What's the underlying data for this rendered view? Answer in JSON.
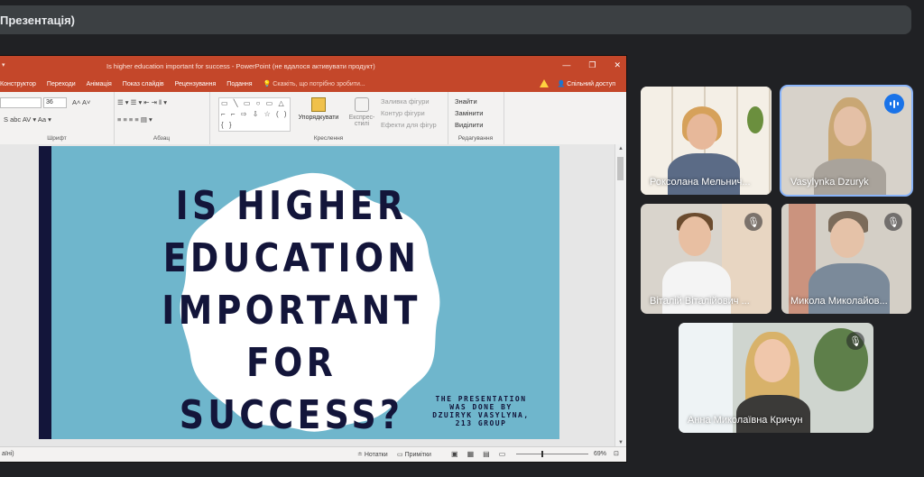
{
  "meeting": {
    "presentation_title": "Презентація)"
  },
  "ppt": {
    "window_title": "Is higher education important for success - PowerPoint (не вдалося активувати продукт)",
    "quick_access": "▾",
    "window_buttons": [
      "—",
      "❐",
      "✕"
    ],
    "tabs": [
      "Конструктор",
      "Переходи",
      "Анімація",
      "Показ слайдів",
      "Рецензування",
      "Подання"
    ],
    "search_hint": "Скажіть, що потрібно зробити...",
    "share_label": "Спільний доступ",
    "ribbon": {
      "font_size": "36",
      "font_buttons": "A˄  A˅",
      "font_format_row": "S  abc  AV ▾  Aa ▾",
      "paragraph_row1": "☰ ▾  ☰ ▾  ⇤  ⇥  ‖ ▾",
      "paragraph_row2": "≡  ≡  ≡  ≡  ▤ ▾",
      "shapes": "▭ ╲ ▭ ○ ▭ △ ⌐ ⌐ ⇨ ⇩ ☆ ( ) { }",
      "arrange_label": "Упорядкувати",
      "quick_styles_label": "Експрес-стилі",
      "shape_fill": "Заливка фігури",
      "shape_outline": "Контур фігури",
      "shape_effects": "Ефекти для фігур",
      "find": "Знайти",
      "replace": "Замінити",
      "select": "Виділити",
      "group_font": "Шрифт",
      "group_paragraph": "Абзац",
      "group_drawing": "Креслення",
      "group_editing": "Редагування"
    },
    "slide": {
      "title_lines": [
        "IS HIGHER",
        "EDUCATION",
        "IMPORTANT FOR",
        "SUCCESS?"
      ],
      "credit_lines": [
        "THE PRESENTATION",
        "WAS DONE BY",
        "DZUIRYK VASYLYNA,",
        "213 GROUP"
      ]
    },
    "status": {
      "left": "аїні)",
      "notes": "Нотатки",
      "comments": "Примітки",
      "zoom": "69%"
    }
  },
  "participants": [
    {
      "name": "Роксолана Мельнич...",
      "muted": false,
      "speaking": false
    },
    {
      "name": "Vasylynka Dzuryk",
      "muted": false,
      "speaking": true
    },
    {
      "name": "Віталій Віталійович ...",
      "muted": true,
      "speaking": false
    },
    {
      "name": "Микола Миколайов...",
      "muted": true,
      "speaking": false
    },
    {
      "name": "Анна Миколаївна Кричун",
      "muted": true,
      "speaking": false
    }
  ],
  "colors": {
    "meet_bg": "#202124",
    "ppt_accent": "#c4472a",
    "slide_bg": "#6fb6cc",
    "slide_text": "#13153a",
    "active_speaker": "#8ab4f8"
  }
}
